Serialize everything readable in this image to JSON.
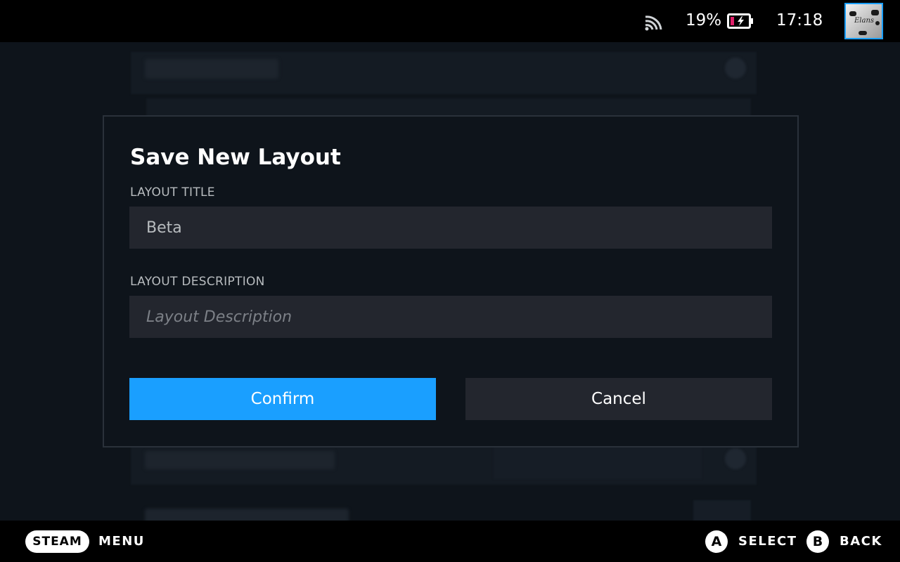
{
  "status_bar": {
    "battery_percent": "19%",
    "time": "17:18",
    "avatar_text": "Elans",
    "icons": [
      "wifi-icon",
      "battery-charging-icon",
      "avatar"
    ]
  },
  "dialog": {
    "title": "Save New Layout",
    "layout_title_label": "LAYOUT TITLE",
    "layout_title_value": "Beta",
    "layout_description_label": "LAYOUT DESCRIPTION",
    "layout_description_placeholder": "Layout Description",
    "confirm_label": "Confirm",
    "cancel_label": "Cancel"
  },
  "bottom_bar": {
    "steam_label": "STEAM",
    "menu_label": "MENU",
    "a_glyph": "A",
    "select_label": "SELECT",
    "b_glyph": "B",
    "back_label": "BACK"
  },
  "colors": {
    "accent": "#1a9fff",
    "background": "#0e141b",
    "field": "#23262e",
    "battery_low": "#e0206a"
  }
}
